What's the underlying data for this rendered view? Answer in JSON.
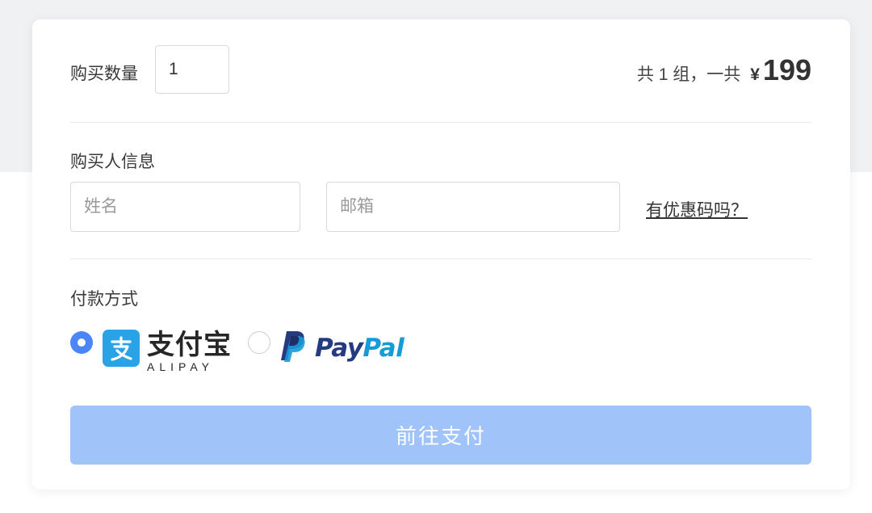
{
  "quantity": {
    "label": "购买数量",
    "value": "1"
  },
  "total": {
    "summary": "共 1 组，一共",
    "currency": "¥",
    "amount": "199"
  },
  "buyer": {
    "section_title": "购买人信息",
    "name_placeholder": "姓名",
    "email_placeholder": "邮箱",
    "coupon_link": "有优惠码吗？"
  },
  "payment": {
    "section_title": "付款方式",
    "options": [
      {
        "id": "alipay",
        "selected": true,
        "logo_cn": "支付宝",
        "logo_en": "ALIPAY",
        "icon": "alipay-icon"
      },
      {
        "id": "paypal",
        "selected": false,
        "logo_part1": "Pay",
        "logo_part2": "Pal",
        "icon": "paypal-icon"
      }
    ]
  },
  "submit": {
    "label": "前往支付"
  },
  "colors": {
    "accent": "#4a86f7",
    "button_disabled": "#a0c3fa",
    "alipay_blue": "#2aa3e6",
    "paypal_dark": "#253b80",
    "paypal_light": "#179bd7"
  }
}
